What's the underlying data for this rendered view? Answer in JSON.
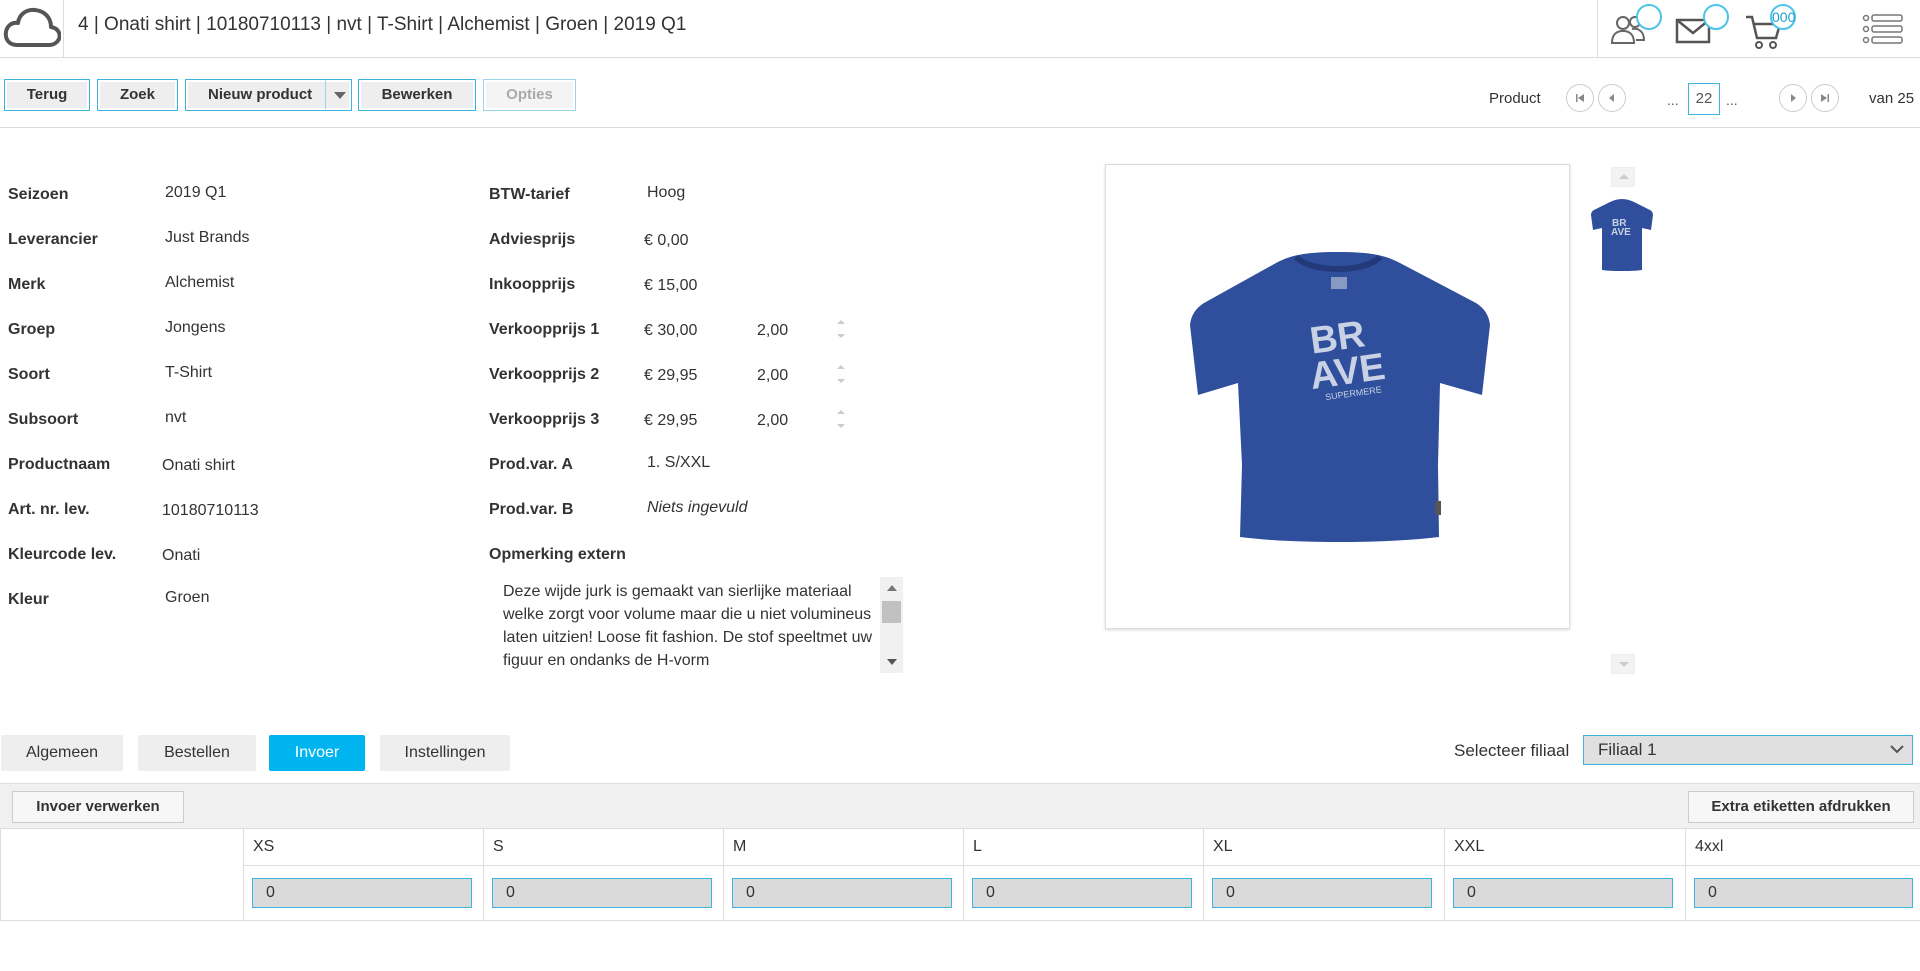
{
  "header": {
    "title": "4 | Onati shirt | 10180710113 | nvt | T-Shirt | Alchemist | Groen | 2019 Q1",
    "cart_count": "000"
  },
  "toolbar": {
    "back_label": "Terug",
    "search_label": "Zoek",
    "new_product_label": "Nieuw product",
    "edit_label": "Bewerken",
    "options_label": "Opties"
  },
  "pager": {
    "label": "Product",
    "dots": "...",
    "current": "22",
    "total_label": "van 25"
  },
  "form_left": [
    {
      "label": "Seizoen",
      "value": "2019 Q1"
    },
    {
      "label": "Leverancier",
      "value": "Just Brands"
    },
    {
      "label": "Merk",
      "value": "Alchemist"
    },
    {
      "label": "Groep",
      "value": "Jongens"
    },
    {
      "label": "Soort",
      "value": "T-Shirt"
    },
    {
      "label": "Subsoort",
      "value": "nvt"
    },
    {
      "label": "Productnaam",
      "value": "Onati shirt"
    },
    {
      "label": "Art. nr. lev.",
      "value": "10180710113"
    },
    {
      "label": "Kleurcode lev.",
      "value": "Onati"
    },
    {
      "label": "Kleur",
      "value": "Groen"
    }
  ],
  "form_right": {
    "btw": {
      "label": "BTW-tarief",
      "value": "Hoog"
    },
    "advies": {
      "label": "Adviesprijs",
      "value": "€ 0,00"
    },
    "inkoop": {
      "label": "Inkoopprijs",
      "value": "€ 15,00"
    },
    "verkoop1": {
      "label": "Verkoopprijs 1",
      "value": "€ 30,00",
      "factor": "2,00"
    },
    "verkoop2": {
      "label": "Verkoopprijs 2",
      "value": "€ 29,95",
      "factor": "2,00"
    },
    "verkoop3": {
      "label": "Verkoopprijs 3",
      "value": "€ 29,95",
      "factor": "2,00"
    },
    "prodvar_a": {
      "label": "Prod.var. A",
      "value": "1. S/XXL"
    },
    "prodvar_b": {
      "label": "Prod.var. B",
      "value": "Niets ingevuld"
    },
    "opmerking": {
      "label": "Opmerking extern",
      "text": "Deze wijde jurk is gemaakt van sierlijke materiaal welke zorgt voor volume maar die u niet volumineus laten uitzien! Loose fit fashion. De stof speeltmet uw figuur en ondanks de H-vorm"
    }
  },
  "product_image": {
    "print_line1": "BR",
    "print_line2": "AVE",
    "print_line3": "SUPERMERE",
    "shirt_color": "#2f4f9c"
  },
  "tabs": [
    {
      "label": "Algemeen"
    },
    {
      "label": "Bestellen"
    },
    {
      "label": "Invoer"
    },
    {
      "label": "Instellingen"
    }
  ],
  "filiaal": {
    "label": "Selecteer filiaal",
    "selected": "Filiaal 1"
  },
  "invoer": {
    "process_label": "Invoer verwerken",
    "print_label": "Extra etiketten afdrukken",
    "sizes": [
      {
        "size": "XS",
        "qty": "0"
      },
      {
        "size": "S",
        "qty": "0"
      },
      {
        "size": "M",
        "qty": "0"
      },
      {
        "size": "L",
        "qty": "0"
      },
      {
        "size": "XL",
        "qty": "0"
      },
      {
        "size": "XXL",
        "qty": "0"
      },
      {
        "size": "4xxl",
        "qty": "0"
      }
    ]
  },
  "colors": {
    "accent": "#3bb4de",
    "active_tab": "#00b5ef"
  }
}
